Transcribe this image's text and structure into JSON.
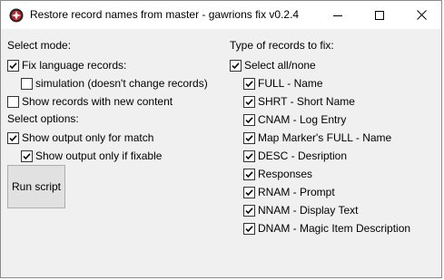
{
  "window": {
    "title": "Restore record names from master - gawrions fix v0.2.4"
  },
  "left": {
    "mode_label": "Select mode:",
    "fix_language": {
      "label": "Fix language records:",
      "checked": true
    },
    "simulation": {
      "label": "simulation (doesn't change records)",
      "checked": false
    },
    "show_new": {
      "label": "Show records with new content",
      "checked": false
    },
    "options_label": "Select options:",
    "output_match": {
      "label": "Show output only for match",
      "checked": true
    },
    "output_fixable": {
      "label": "Show output only if fixable",
      "checked": true
    },
    "run_button": "Run script"
  },
  "right": {
    "types_label": "Type of records to fix:",
    "select_all": {
      "label": "Select all/none",
      "checked": true
    },
    "types": [
      {
        "label": "FULL - Name",
        "checked": true
      },
      {
        "label": "SHRT - Short Name",
        "checked": true
      },
      {
        "label": "CNAM - Log Entry",
        "checked": true
      },
      {
        "label": "Map Marker's FULL - Name",
        "checked": true
      },
      {
        "label": "DESC - Desription",
        "checked": true
      },
      {
        "label": "Responses",
        "checked": true
      },
      {
        "label": "RNAM - Prompt",
        "checked": true
      },
      {
        "label": "NNAM - Display Text",
        "checked": true
      },
      {
        "label": "DNAM - Magic Item Description",
        "checked": true
      }
    ]
  }
}
